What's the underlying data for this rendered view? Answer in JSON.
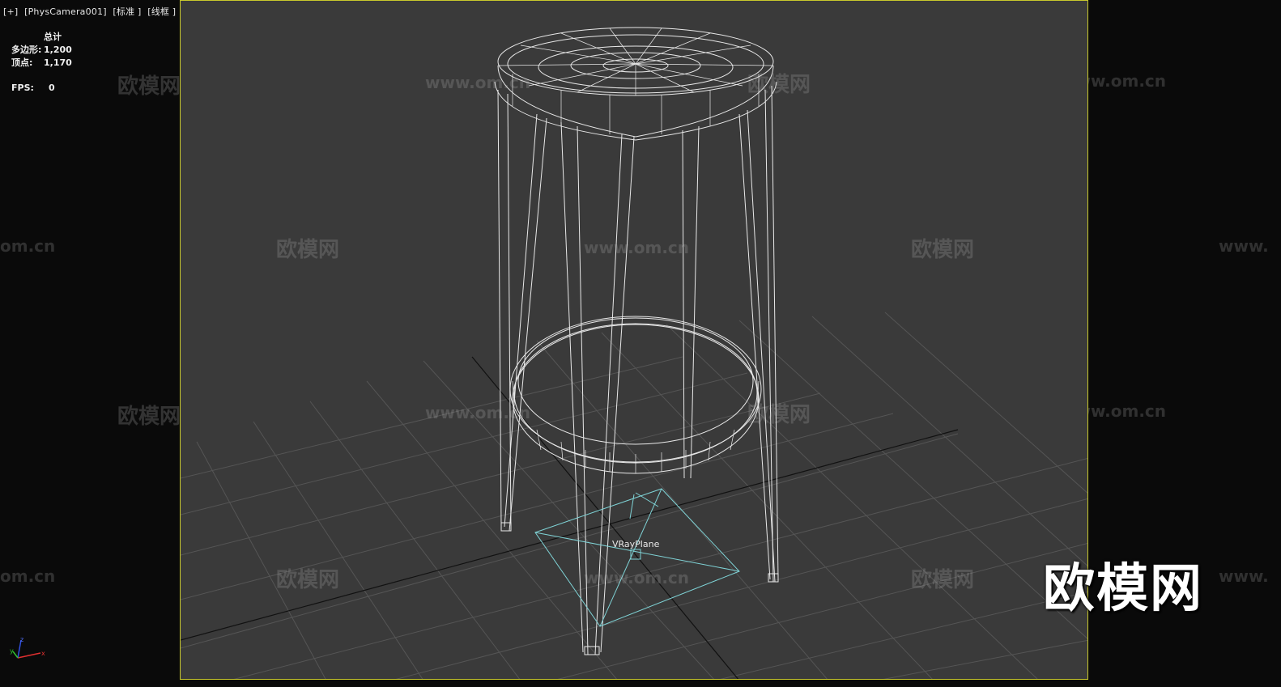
{
  "viewport_label": {
    "plus": "[+]",
    "camera": "[PhysCamera001]",
    "shading_mode": "[标准 ]",
    "display_mode": "[线框 ]"
  },
  "stats": {
    "header": "总计",
    "polygons_label": "多边形:",
    "polygons_value": "1,200",
    "vertices_label": "顶点:",
    "vertices_value": "1,170",
    "fps_label": "FPS:",
    "fps_value": "0"
  },
  "scene": {
    "object_label": "VRayPlane"
  },
  "watermarks": {
    "brand": "欧模网",
    "url": "www.om.cn",
    "url_partial_left": "om.cn",
    "url_partial_right": "www."
  },
  "logo_text": "欧模网",
  "gizmo": {
    "x": "x",
    "y": "y",
    "z": "z"
  },
  "colors": {
    "viewport_border": "#c9c92c",
    "viewport_bg": "#3a3a3a",
    "wireframe": "#e8e8e8",
    "light_plane": "#7fd3d6"
  }
}
